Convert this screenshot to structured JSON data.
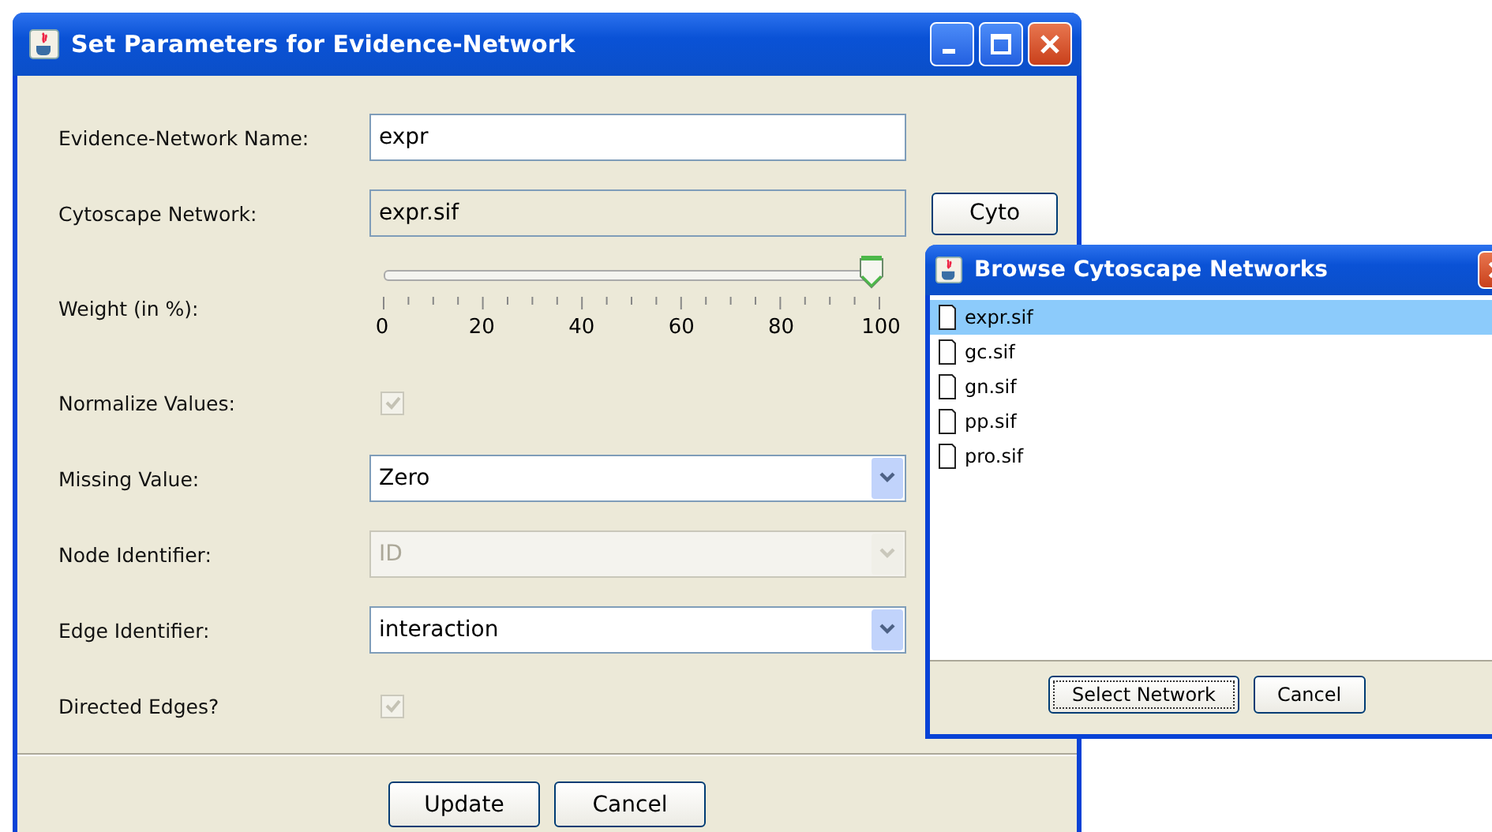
{
  "main_window": {
    "title": "Set Parameters for Evidence-Network",
    "fields": [
      {
        "kind": "text",
        "label": "Evidence-Network Name:",
        "value": "expr"
      },
      {
        "kind": "readonly",
        "label": "Cytoscape Network:",
        "value": "expr.sif",
        "button": "Cyto"
      },
      {
        "kind": "slider",
        "label": "Weight (in %):",
        "level": 1,
        "tick_labels": [
          "0",
          "20",
          "40",
          "60",
          "80",
          "100"
        ]
      },
      {
        "kind": "checkbox",
        "label": "Normalize Values:",
        "checked": true,
        "disabled": true
      },
      {
        "kind": "combo",
        "label": "Missing Value:",
        "value": "Zero",
        "disabled": false
      },
      {
        "kind": "combo",
        "label": "Node Identifier:",
        "value": "ID",
        "disabled": true
      },
      {
        "kind": "combo",
        "label": "Edge Identifier:",
        "value": "interaction",
        "disabled": false
      },
      {
        "kind": "checkbox",
        "label": "Directed Edges?",
        "checked": true,
        "disabled": true
      }
    ],
    "buttons": [
      "Update",
      "Cancel"
    ]
  },
  "browse_dialog": {
    "title": "Browse Cytoscape Networks",
    "files": [
      {
        "name": "expr.sif",
        "selected": true
      },
      {
        "name": "gc.sif",
        "selected": false
      },
      {
        "name": "gn.sif",
        "selected": false
      },
      {
        "name": "pp.sif",
        "selected": false
      },
      {
        "name": "pro.sif",
        "selected": false
      }
    ],
    "buttons": [
      "Select Network",
      "Cancel"
    ]
  }
}
